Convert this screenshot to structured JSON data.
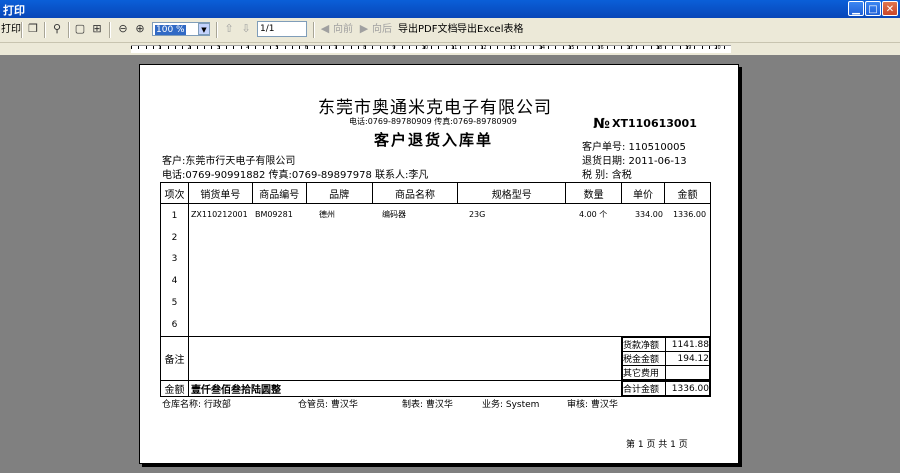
{
  "window": {
    "title": "打印"
  },
  "toolbar": {
    "print_label": "打印",
    "zoom_value": "100 %",
    "page_value": "1/1",
    "prev_label": "向前",
    "next_label": "向后",
    "export_pdf_label": "导出PDF文档",
    "export_excel_label": "导出Excel表格"
  },
  "ruler": {
    "numbers": [
      "1",
      "2",
      "3",
      "4",
      "5",
      "6",
      "7",
      "8",
      "9",
      "10",
      "11",
      "12",
      "13",
      "14",
      "15",
      "16",
      "17",
      "18",
      "19",
      "20"
    ]
  },
  "document": {
    "company": "东莞市奥通米克电子有限公司",
    "contact": "电话:0769-89780909   传真:0769-89780909",
    "title": "客户退货入库单",
    "no_label": "№",
    "no_value": "XT110613001",
    "customer_line": "客户:东莞市行天电子有限公司",
    "phone_line": "电话:0769-90991882  传真:0769-89897978  联系人:李凡",
    "customer_no": "客户单号: 110510005",
    "return_date": "退货日期: 2011-06-13",
    "tax_type": "税    别: 含税",
    "headers": [
      "项次",
      "销货单号",
      "商品编号",
      "品牌",
      "商品名称",
      "规格型号",
      "数量",
      "单价",
      "金额"
    ],
    "rows": [
      {
        "no": "1",
        "sales_no": "ZX110212001",
        "item_no": "BM09281",
        "brand": "德州",
        "name": "编码器",
        "spec": "23G",
        "qty": "4.00 个",
        "price": "334.00",
        "amount": "1336.00"
      },
      {
        "no": "2"
      },
      {
        "no": "3"
      },
      {
        "no": "4"
      },
      {
        "no": "5"
      },
      {
        "no": "6"
      }
    ],
    "remark_label": "备注",
    "summary": [
      {
        "label": "货款净额",
        "value": "1141.88"
      },
      {
        "label": "税金金额",
        "value": "194.12"
      },
      {
        "label": "其它费用",
        "value": ""
      },
      {
        "label": "合计金额",
        "value": "1336.00"
      }
    ],
    "amount_label": "金额",
    "amount_words": "壹仟叁佰叁拾陆圆整",
    "warehouse": "仓库名称: 行政部",
    "keeper": "仓管员: 曹汉华",
    "maker": "制表: 曹汉华",
    "business": "业务: System",
    "auditor": "审核: 曹汉华",
    "page_info": "第 1 页 共 1 页"
  }
}
